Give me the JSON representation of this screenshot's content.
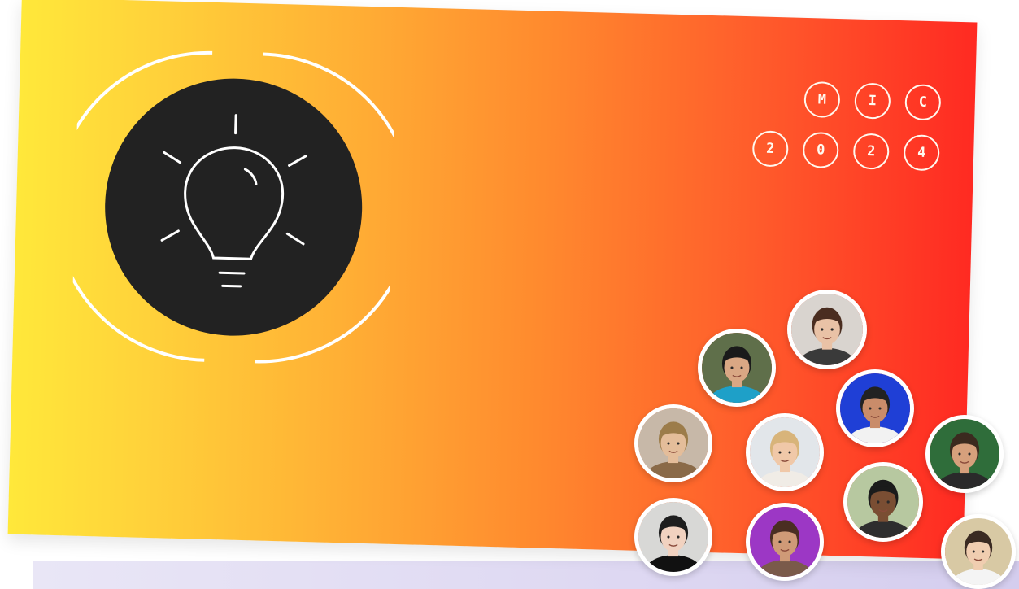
{
  "badge": {
    "letters": [
      "M",
      "I",
      "C"
    ],
    "digits": [
      "2",
      "0",
      "2",
      "4"
    ]
  },
  "icons": {
    "main": "lightbulb-icon",
    "people": "attendee-photo"
  },
  "colors": {
    "gradient_start": "#ffe83a",
    "gradient_mid": "#ff9a30",
    "gradient_end": "#ff2a22",
    "disc": "#222222",
    "ring": "#ffffff"
  },
  "avatars": [
    {
      "name": "attendee-1",
      "skin": "#e9c2a6",
      "hair": "#4a2d20",
      "bg": "#d9d4cf",
      "shirt": "#3a3a3a"
    },
    {
      "name": "attendee-2",
      "skin": "#d9a784",
      "hair": "#1a1a1a",
      "bg": "#5f6f4a",
      "shirt": "#1ea0c8"
    },
    {
      "name": "attendee-3",
      "skin": "#c98c6a",
      "hair": "#222222",
      "bg": "#1f3fd6",
      "shirt": "#f2f2f2"
    },
    {
      "name": "attendee-4",
      "skin": "#e4bd9a",
      "hair": "#9c7c4a",
      "bg": "#c7b8a8",
      "shirt": "#8a6a48"
    },
    {
      "name": "attendee-5",
      "skin": "#f0c8a8",
      "hair": "#d8b47a",
      "bg": "#e2e6ea",
      "shirt": "#f0ece6"
    },
    {
      "name": "attendee-6",
      "skin": "#d6a07c",
      "hair": "#3b2a1f",
      "bg": "#2f6d3a",
      "shirt": "#2a2a2a"
    },
    {
      "name": "attendee-7",
      "skin": "#7a4e33",
      "hair": "#1b1b1b",
      "bg": "#b7c8a0",
      "shirt": "#2e2e2e"
    },
    {
      "name": "attendee-8",
      "skin": "#f1d2c0",
      "hair": "#1e1e1e",
      "bg": "#d8d8d6",
      "shirt": "#111111"
    },
    {
      "name": "attendee-9",
      "skin": "#cf9a77",
      "hair": "#4a2e22",
      "bg": "#9c37c5",
      "shirt": "#7a5a4a"
    },
    {
      "name": "attendee-10",
      "skin": "#f0cdb0",
      "hair": "#3a2a22",
      "bg": "#d8c9a4",
      "shirt": "#f4f4f4"
    }
  ]
}
